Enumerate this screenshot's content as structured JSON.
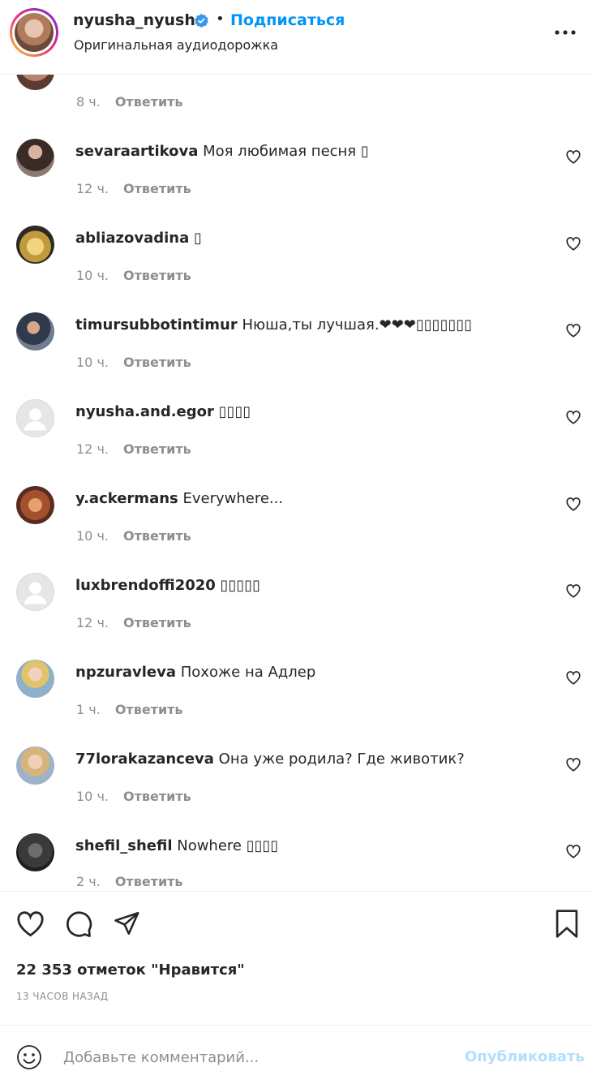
{
  "header": {
    "username": "nyusha_nyusha",
    "follow_label": "Подписаться",
    "dot": "•",
    "subtitle": "Оригинальная аудиодорожка",
    "accent_color": "#0095f6"
  },
  "comments": [
    {
      "user": "",
      "text": "",
      "time": "8 ч.",
      "reply": "Ответить",
      "partial": true
    },
    {
      "user": "sevaraartikova",
      "text": "Моя любимая песня ▯",
      "time": "12 ч.",
      "reply": "Ответить"
    },
    {
      "user": "abliazovadina",
      "text": "▯",
      "time": "10 ч.",
      "reply": "Ответить"
    },
    {
      "user": "timursubbotintimur",
      "text": "Нюша,ты лучшая.❤❤❤▯▯▯▯▯▯▯",
      "time": "10 ч.",
      "reply": "Ответить"
    },
    {
      "user": "nyusha.and.egor",
      "text": "▯▯▯▯",
      "time": "12 ч.",
      "reply": "Ответить"
    },
    {
      "user": "y.ackermans",
      "text": "Everywhere...",
      "time": "10 ч.",
      "reply": "Ответить"
    },
    {
      "user": "luxbrendoffi2020",
      "text": "▯▯▯▯▯",
      "time": "12 ч.",
      "reply": "Ответить"
    },
    {
      "user": "npzuravleva",
      "text": "Похоже на Адлер",
      "time": "1 ч.",
      "reply": "Ответить"
    },
    {
      "user": "77lorakazanceva",
      "text": "Она уже родила? Где животик?",
      "time": "10 ч.",
      "reply": "Ответить"
    },
    {
      "user": "shefil_shefil",
      "text": "Nowhere ▯▯▯▯",
      "time": "2 ч.",
      "reply": "Ответить"
    }
  ],
  "footer": {
    "likes": "22 353 отметок \"Нравится\"",
    "time_ago": "13 ЧАСОВ НАЗАД",
    "comment_placeholder": "Добавьте комментарий...",
    "publish_label": "Опубликовать",
    "publish_color": "#b2dffc"
  },
  "icons": {
    "header": [
      "verified-badge-icon",
      "more-options-icon"
    ],
    "comment": [
      "heart-icon"
    ],
    "actions": [
      "heart-icon",
      "comment-icon",
      "share-icon",
      "bookmark-icon"
    ],
    "input": [
      "smiley-icon"
    ]
  }
}
